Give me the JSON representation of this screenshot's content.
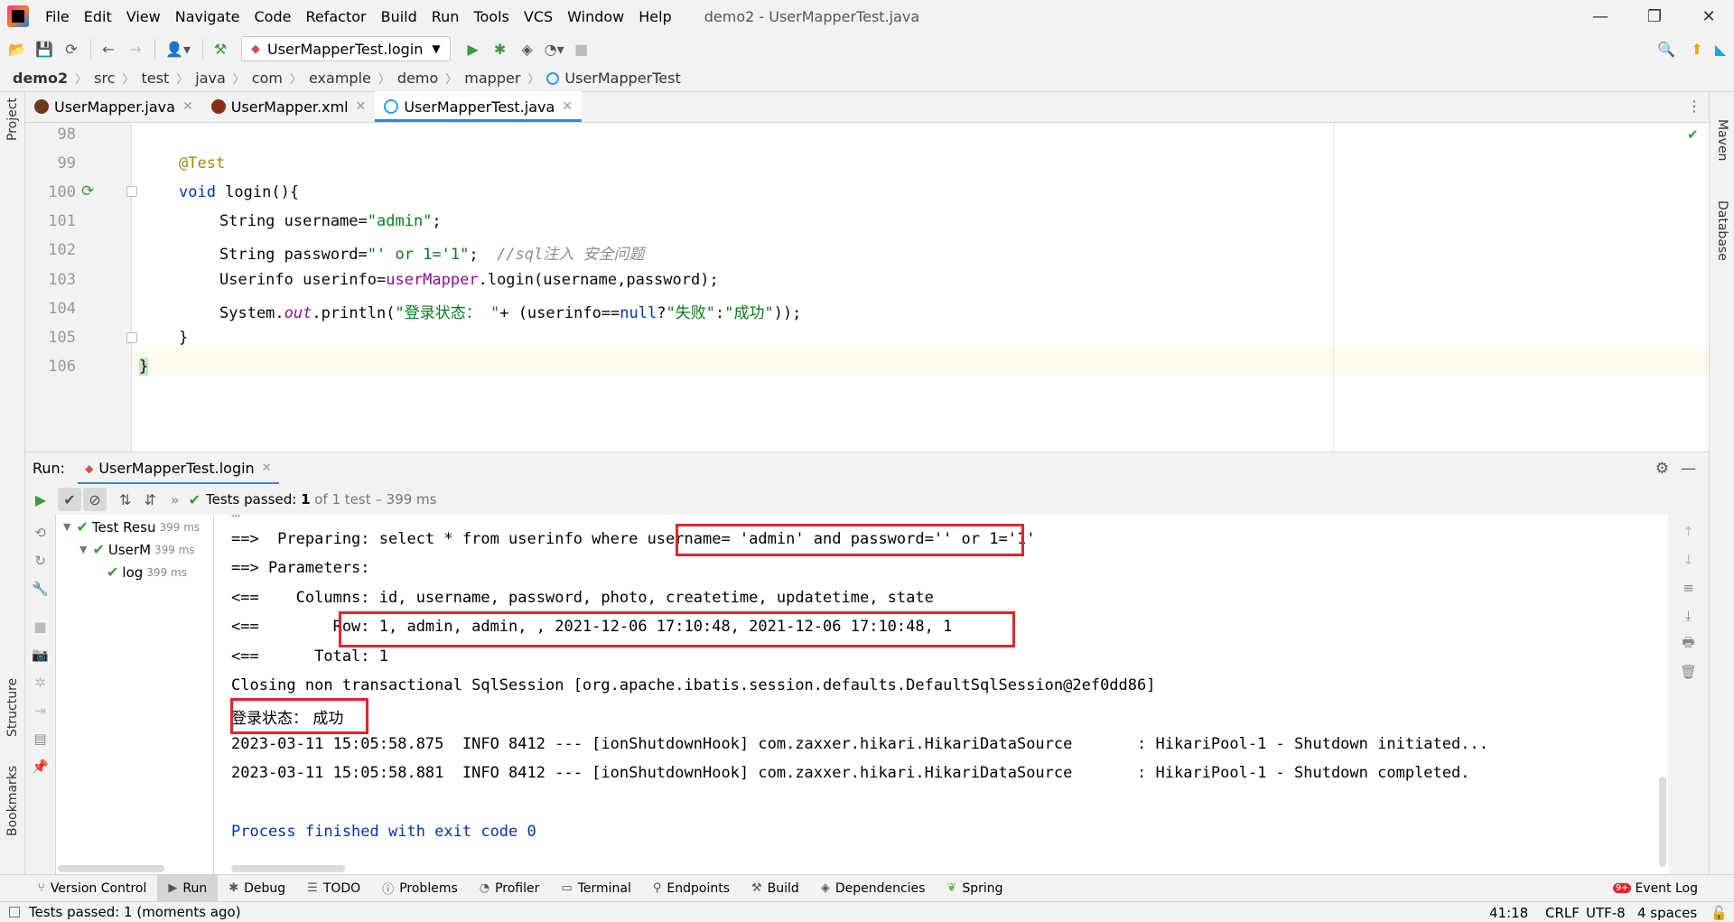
{
  "menu": {
    "items": [
      "File",
      "Edit",
      "View",
      "Navigate",
      "Code",
      "Refactor",
      "Build",
      "Run",
      "Tools",
      "VCS",
      "Window",
      "Help"
    ],
    "window_title": "demo2 - UserMapperTest.java"
  },
  "toolbar": {
    "run_config": "UserMapperTest.login"
  },
  "breadcrumb": [
    "demo2",
    "src",
    "test",
    "java",
    "com",
    "example",
    "demo",
    "mapper",
    "UserMapperTest"
  ],
  "side_tools": {
    "left_top": "Project",
    "left_mid": "Structure",
    "left_bottom": "Bookmarks",
    "right_top": "Maven",
    "right_mid": "Database"
  },
  "editor_tabs": [
    {
      "label": "UserMapper.java",
      "active": false
    },
    {
      "label": "UserMapper.xml",
      "active": false
    },
    {
      "label": "UserMapperTest.java",
      "active": true
    }
  ],
  "code": {
    "line_numbers": [
      "98",
      "99",
      "100",
      "101",
      "102",
      "103",
      "104",
      "105",
      "106"
    ],
    "l99": "@Test",
    "l100_kw": "void",
    "l100_rest": " login(){",
    "l101_a": "String username=",
    "l101_s": "\"admin\"",
    "l101_e": ";",
    "l102_a": "String password=",
    "l102_s": "\"' or 1='1\"",
    "l102_e": ";  ",
    "l102_c": "//sql注入 安全问题",
    "l103_a": "Userinfo userinfo=",
    "l103_f": "userMapper",
    "l103_e": ".login(username,password);",
    "l104_a": "System.",
    "l104_f": "out",
    "l104_b": ".println(",
    "l104_s1": "\"登录状态： \"",
    "l104_c": "+ (userinfo==",
    "l104_kw": "null",
    "l104_d": "?",
    "l104_s2": "\"失败\"",
    "l104_x": ":",
    "l104_s3": "\"成功\"",
    "l104_e": "));",
    "l105": "}",
    "l106": "}"
  },
  "run_panel": {
    "label": "Run:",
    "tab": "UserMapperTest.login",
    "status_prefix": "Tests passed: ",
    "status_count": "1",
    "status_suffix": " of 1 test – 399 ms"
  },
  "test_tree": [
    {
      "label": "Test Resu",
      "time": "399 ms"
    },
    {
      "label": "UserM",
      "time": "399 ms"
    },
    {
      "label": "log",
      "time": "399 ms"
    }
  ],
  "console": {
    "lines": [
      "==>  Preparing: select * from userinfo where username= 'admin' and password='' or 1='1'",
      "==> Parameters: ",
      "<==    Columns: id, username, password, photo, createtime, updatetime, state",
      "<==        Row: 1, admin, admin, , 2021-12-06 17:10:48, 2021-12-06 17:10:48, 1",
      "<==      Total: 1",
      "Closing non transactional SqlSession [org.apache.ibatis.session.defaults.DefaultSqlSession@2ef0dd86]",
      "登录状态： 成功",
      "2023-03-11 15:05:58.875  INFO 8412 --- [ionShutdownHook] com.zaxxer.hikari.HikariDataSource       : HikariPool-1 - Shutdown initiated...",
      "2023-03-11 15:05:58.881  INFO 8412 --- [ionShutdownHook] com.zaxxer.hikari.HikariDataSource       : HikariPool-1 - Shutdown completed.",
      "",
      "Process finished with exit code 0"
    ]
  },
  "bottom_tabs": [
    "Version Control",
    "Run",
    "Debug",
    "TODO",
    "Problems",
    "Profiler",
    "Terminal",
    "Endpoints",
    "Build",
    "Dependencies",
    "Spring"
  ],
  "event_log": {
    "badge": "9+",
    "label": "Event Log"
  },
  "status": {
    "message": "Tests passed: 1 (moments ago)",
    "position": "41:18",
    "line_sep": "CRLF",
    "encoding": "UTF-8",
    "indent": "4 spaces"
  }
}
